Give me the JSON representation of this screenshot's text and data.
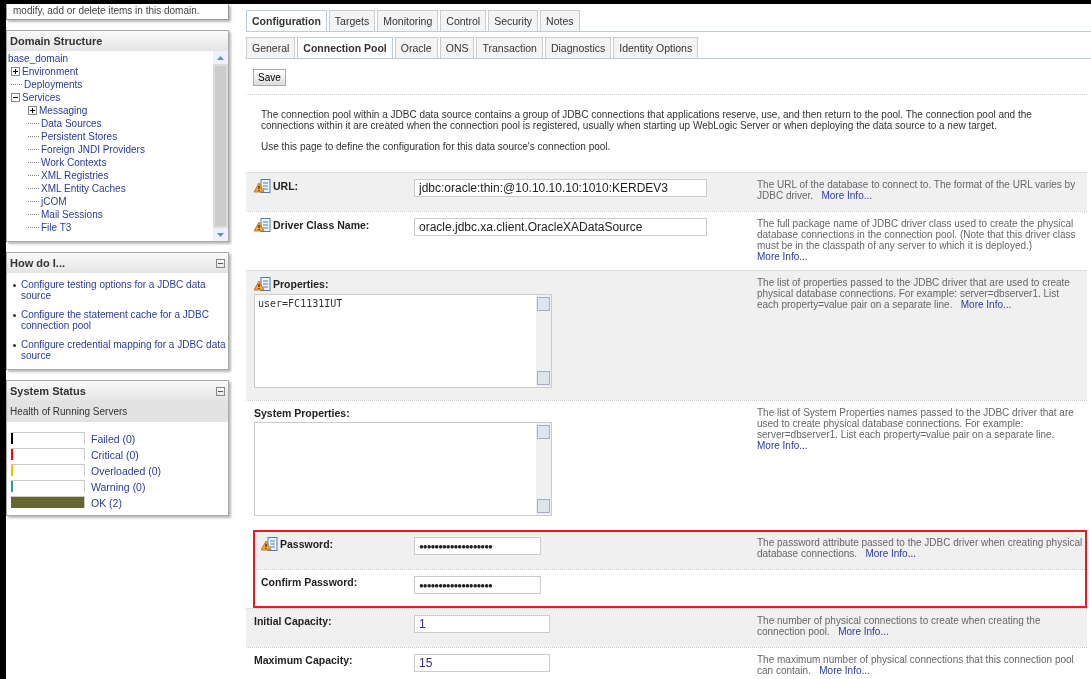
{
  "help_box": {
    "text": "modify, add or delete items in this domain."
  },
  "domain_structure": {
    "title": "Domain Structure",
    "root": "base_domain",
    "items": [
      {
        "label": "Environment",
        "expanded": false
      },
      {
        "label": "Deployments"
      },
      {
        "label": "Services",
        "expanded": true,
        "children": [
          {
            "label": "Messaging",
            "expanded": false
          },
          {
            "label": "Data Sources"
          },
          {
            "label": "Persistent Stores"
          },
          {
            "label": "Foreign JNDI Providers"
          },
          {
            "label": "Work Contexts"
          },
          {
            "label": "XML Registries"
          },
          {
            "label": "XML Entity Caches"
          },
          {
            "label": "jCOM"
          },
          {
            "label": "Mail Sessions"
          },
          {
            "label": "File T3"
          }
        ]
      }
    ]
  },
  "how_do_i": {
    "title": "How do I...",
    "links": [
      "Configure testing options for a JDBC data source",
      "Configure the statement cache for a JDBC connection pool",
      "Configure credential mapping for a JDBC data source"
    ]
  },
  "system_status": {
    "title": "System Status",
    "subtitle": "Health of Running Servers",
    "servers": [
      {
        "label": "Failed (0)",
        "color": "#000000",
        "level": 0
      },
      {
        "label": "Critical (0)",
        "color": "#ff0000",
        "level": 0
      },
      {
        "label": "Overloaded (0)",
        "color": "#f0c000",
        "level": 0
      },
      {
        "label": "Warning (0)",
        "color": "#339999",
        "level": 0
      },
      {
        "label": "OK (2)",
        "color": "#666633",
        "level": 1
      }
    ]
  },
  "tabs": [
    {
      "label": "Configuration",
      "selected": true
    },
    {
      "label": "Targets",
      "selected": false
    },
    {
      "label": "Monitoring",
      "selected": false
    },
    {
      "label": "Control",
      "selected": false
    },
    {
      "label": "Security",
      "selected": false
    },
    {
      "label": "Notes",
      "selected": false
    }
  ],
  "subtabs": [
    {
      "label": "General",
      "selected": false
    },
    {
      "label": "Connection Pool",
      "selected": true
    },
    {
      "label": "Oracle",
      "selected": false
    },
    {
      "label": "ONS",
      "selected": false
    },
    {
      "label": "Transaction",
      "selected": false
    },
    {
      "label": "Diagnostics",
      "selected": false
    },
    {
      "label": "Identity Options",
      "selected": false
    }
  ],
  "save_button": "Save",
  "intro": [
    "The connection pool within a JDBC data source contains a group of JDBC connections that applications reserve, use, and then return to the pool. The connection pool and the connections within it are created when the connection pool is registered, usually when starting up WebLogic Server or when deploying the data source to a new target.",
    "Use this page to define the configuration for this data source's connection pool."
  ],
  "fields": [
    {
      "kind": "text",
      "label": "URL:",
      "warning": true,
      "highlighted": false,
      "value": "jdbc:oracle:thin:@10.10.10.10:1010:KERDEV3",
      "help": "The URL of the database to connect to. The format of the URL varies by JDBC driver.",
      "more": "More Info..."
    },
    {
      "kind": "text",
      "label": "Driver Class Name:",
      "warning": true,
      "highlighted": false,
      "value": "oracle.jdbc.xa.client.OracleXADataSource",
      "help": "The full package name of JDBC driver class used to create the physical database connections in the connection pool. (Note that this driver class must be in the classpath of any server to which it is deployed.)",
      "more": "More Info..."
    },
    {
      "kind": "textarea",
      "label": "Properties:",
      "warning": true,
      "highlighted": false,
      "value": "user=FC1131IUT",
      "help": "The list of properties passed to the JDBC driver that are used to create physical database connections. For example: server=dbserver1. List each property=value pair on a separate line.",
      "more": "More Info..."
    },
    {
      "kind": "textarea",
      "label": "System Properties:",
      "warning": false,
      "highlighted": false,
      "help": "The list of System Properties names passed to the JDBC driver that are used to create physical database connections. For example: server=dbserver1. List each property=value pair on a separate line.",
      "more": "More Info..."
    },
    {
      "kind": "password",
      "label": "Password:",
      "warning": true,
      "highlighted": true,
      "value": "●●●●●●●●●●●●●●●●●●●",
      "help": "The password attribute passed to the JDBC driver when creating physical database connections.",
      "more": "More Info..."
    },
    {
      "kind": "password",
      "label": "Confirm Password:",
      "warning": false,
      "highlighted": true,
      "value": "●●●●●●●●●●●●●●●●●●●"
    },
    {
      "kind": "number",
      "label": "Initial Capacity:",
      "warning": false,
      "highlighted": false,
      "value": "1",
      "help": "The number of physical connections to create when creating the connection pool.",
      "more": "More Info..."
    },
    {
      "kind": "number",
      "label": "Maximum Capacity:",
      "warning": false,
      "highlighted": false,
      "value": "15",
      "help": "The maximum number of physical connections that this connection pool can contain.",
      "more": "More Info..."
    }
  ]
}
